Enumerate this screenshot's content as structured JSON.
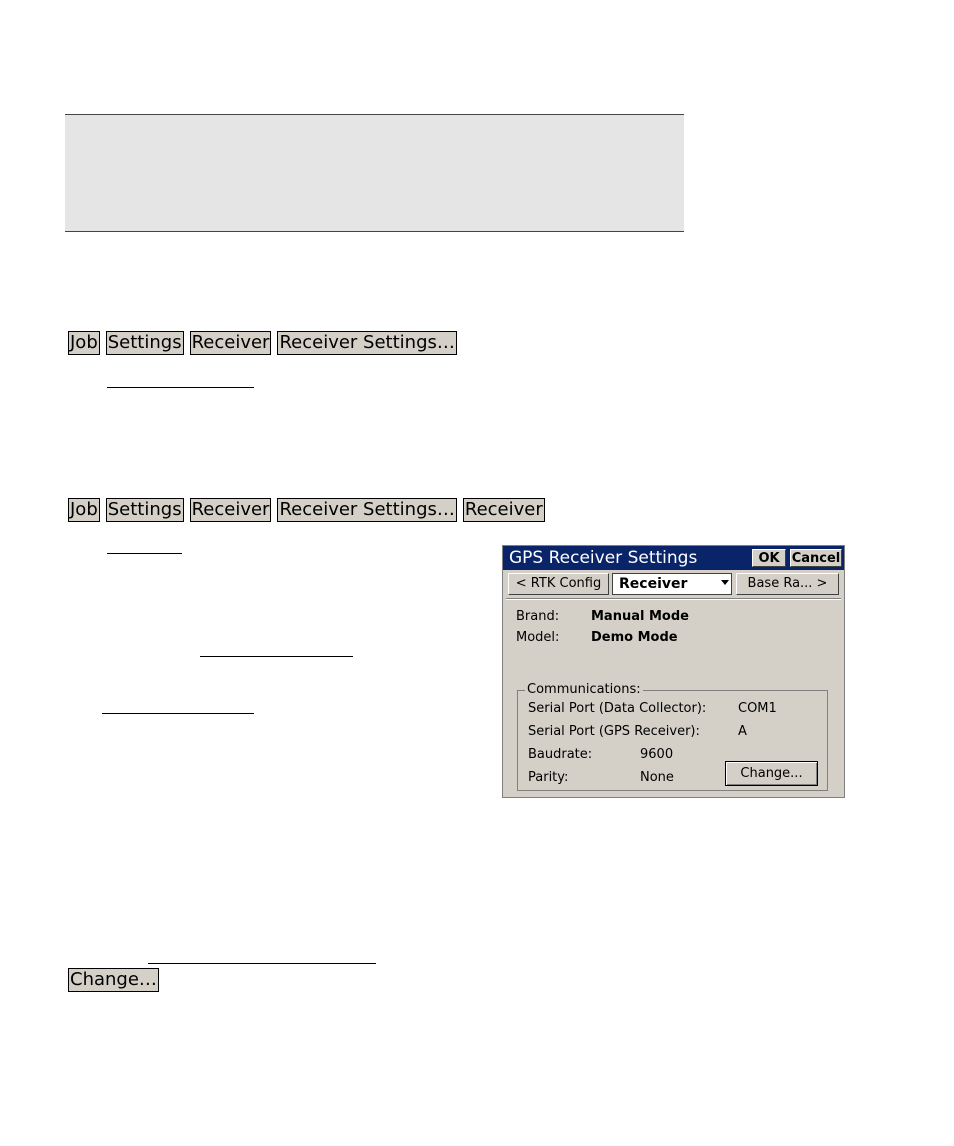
{
  "breadcrumb1": [
    "Job",
    "Settings",
    "Receiver",
    "Receiver Settings…"
  ],
  "breadcrumb2": [
    "Job",
    "Settings",
    "Receiver",
    "Receiver Settings…",
    "Receiver"
  ],
  "change_button_label": "Change…",
  "dialog": {
    "title": "GPS Receiver Settings",
    "ok_label": "OK",
    "cancel_label": "Cancel",
    "prev_tab_label": "< RTK Config",
    "current_tab": "Receiver",
    "next_tab_label": "Base Ra... >",
    "brand_label": "Brand:",
    "brand_value": "Manual Mode",
    "model_label": "Model:",
    "model_value": "Demo Mode",
    "group_title": "Communications:",
    "serial_dc_label": "Serial Port (Data Collector):",
    "serial_dc_value": "COM1",
    "serial_gps_label": "Serial Port (GPS Receiver):",
    "serial_gps_value": "A",
    "baud_label": "Baudrate:",
    "baud_value": "9600",
    "parity_label": "Parity:",
    "parity_value": "None",
    "change_label": "Change..."
  }
}
